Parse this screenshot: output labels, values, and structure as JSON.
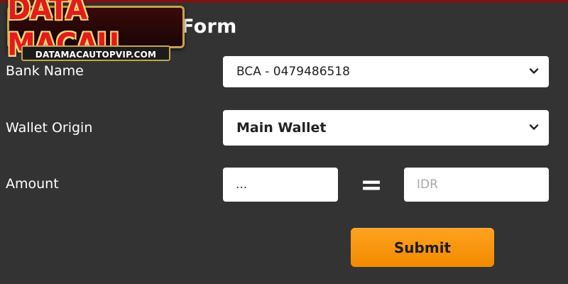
{
  "form": {
    "title": "Form"
  },
  "logo": {
    "name": "DATA MACAU",
    "url": "DATAMACAUTOPVIP.COM"
  },
  "fields": {
    "bank_label": "Bank Name",
    "bank_value": "BCA - 0479486518",
    "wallet_label": "Wallet Origin",
    "wallet_value": "Main Wallet",
    "amount_label": "Amount",
    "amount_placeholder": "...",
    "equals_sign": "=",
    "idr_placeholder": "IDR"
  },
  "actions": {
    "submit_label": "Submit"
  },
  "icons": {
    "select_arrow": "chevron-down-icon"
  },
  "colors": {
    "background": "#333333",
    "accent": "#f7941d",
    "logo_red": "#e31b1b",
    "logo_gold": "#c9a24a"
  }
}
